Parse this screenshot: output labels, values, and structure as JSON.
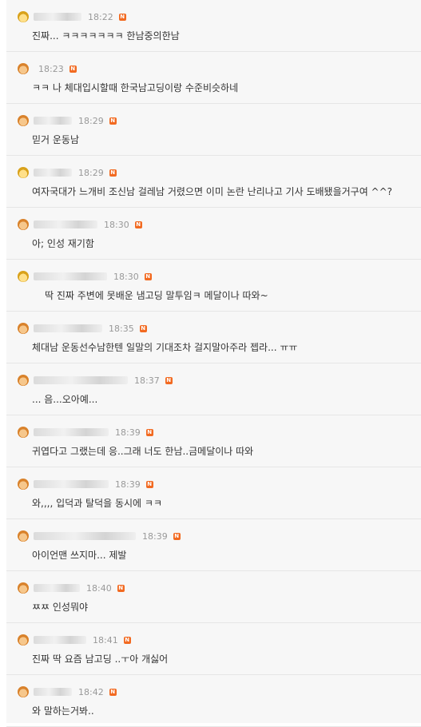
{
  "badge_label": "N",
  "colors": {
    "new_badge": "#f26a21",
    "time": "#999999",
    "text": "#333333",
    "panel_bg": "#f7f7f7"
  },
  "comments": [
    {
      "time": "18:22",
      "text": "진짜... ㅋㅋㅋㅋㅋㅋㅋ 한남중의한남"
    },
    {
      "time": "18:23",
      "text": "ㅋㅋ 나 체대입시할때 한국남고딩이랑 수준비슷하네"
    },
    {
      "time": "18:29",
      "text": "믿거 운동남"
    },
    {
      "time": "18:29",
      "text": "여자국대가 느개비 조신남 걸레남 거렸으면 이미 논란 난리나고 기사 도배됐을거구여 ^^?"
    },
    {
      "time": "18:30",
      "text": "아; 인성 재기함"
    },
    {
      "time": "18:30",
      "text": "딱 진짜 주변에 못배운 냄고딩 말투임ㅋ 메달이나 따와~"
    },
    {
      "time": "18:35",
      "text": "체대남 운동선수남한텐 일말의 기대조차 걸지말아주라 젭라... ㅠㅠ"
    },
    {
      "time": "18:37",
      "text": "... 음...오아예..."
    },
    {
      "time": "18:39",
      "text": "귀엽다고 그랬는데 응..그래 너도 한남..금메달이나 따와"
    },
    {
      "time": "18:39",
      "text": "와,,,, 입덕과 탈덕을 동시에 ㅋㅋ"
    },
    {
      "time": "18:39",
      "text": "아이언맨 쓰지마... 제발"
    },
    {
      "time": "18:40",
      "text": "ㅉㅉ 인성뭐야"
    },
    {
      "time": "18:41",
      "text": "진짜 딱 요즘 남고딩 ..ㅜ아 개싫어"
    },
    {
      "time": "18:42",
      "text": "와 말하는거봐.."
    }
  ]
}
